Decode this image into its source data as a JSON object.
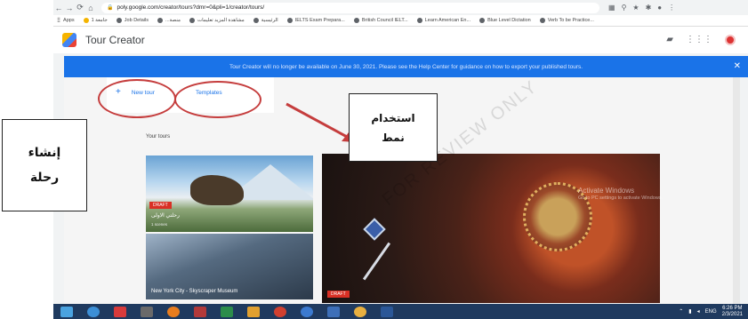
{
  "browser": {
    "url": "poly.google.com/creator/tours?dmr=0&pli=1/creator/tours/",
    "nav": [
      "←",
      "→",
      "⟳",
      "⌂"
    ],
    "bookmarks": [
      "Apps",
      "جامعة 1",
      "Job Details",
      "...منصة",
      "مشاهدة المزيد تعليمات",
      "الرئيسية",
      "IELTS Exam Prepara...",
      "British Council IELT...",
      "Learn American En...",
      "Blue Level Dictation",
      "Verb To be Practice..."
    ]
  },
  "app": {
    "title": "Tour Creator",
    "banner": "Tour Creator will no longer be available on June 30, 2021. Please see the Help Center for guidance on how to export your published tours.",
    "banner_close": "✕",
    "new_tour_label": "New tour",
    "templates_label": "Templates",
    "your_tours_label": "Your tours",
    "tours": [
      {
        "badge": "DRAFT",
        "title": "رحلتي الاولى",
        "subtitle": "1 scenes"
      },
      {
        "badge": "",
        "title": "New York City - Skyscraper Museum",
        "subtitle": ""
      },
      {
        "badge": "DRAFT",
        "title": "",
        "subtitle": ""
      }
    ]
  },
  "callouts": {
    "left": [
      "إنشاء",
      "رحلة"
    ],
    "middle": [
      "استخدام",
      "نمط"
    ]
  },
  "watermark": {
    "line1": "Activate Windows",
    "line2": "Go to PC settings to activate Windows."
  },
  "background_watermark": "FOR REVIEW ONLY",
  "taskbar": {
    "time": "6:26 PM",
    "date": "2/3/2021",
    "lang": "ENG"
  },
  "colors": {
    "banner": "#1a73e8",
    "accent": "#1a73e8",
    "annotation": "#c53d3d",
    "draft": "#d93025",
    "taskbar": "#1f3a5f"
  }
}
